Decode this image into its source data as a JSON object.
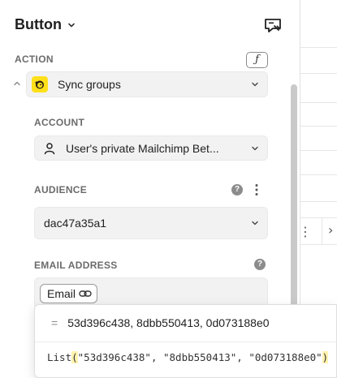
{
  "header": {
    "title": "Button"
  },
  "action": {
    "section_label": "ACTION",
    "fx_label": "ƒ",
    "selected": "Sync groups"
  },
  "account": {
    "section_label": "ACCOUNT",
    "selected": "User's private Mailchimp Bet..."
  },
  "audience": {
    "section_label": "AUDIENCE",
    "selected": "dac47a35a1",
    "help": "?"
  },
  "email": {
    "section_label": "EMAIL ADDRESS",
    "tag_label": "Email",
    "help": "?"
  },
  "popup": {
    "equals": "=",
    "result": "53d396c438, 8dbb550413, 0d073188e0",
    "code_fn": "List",
    "code_open": "(",
    "code_args": "\"53d396c438\", \"8dbb550413\", \"0d073188e0\"",
    "code_close": ")"
  },
  "colors": {
    "mailchimp_yellow": "#ffe01b",
    "field_bg": "#f2f2f2",
    "section_label": "#6b6b6b",
    "paren_highlight": "#fff3b0"
  },
  "icons": {
    "title_dropdown": "chevron-down-icon",
    "header_action": "comment-edit-icon",
    "collapse": "chevron-up-icon",
    "account": "user-icon",
    "email_tag": "link-icon",
    "more": "kebab-icon"
  }
}
